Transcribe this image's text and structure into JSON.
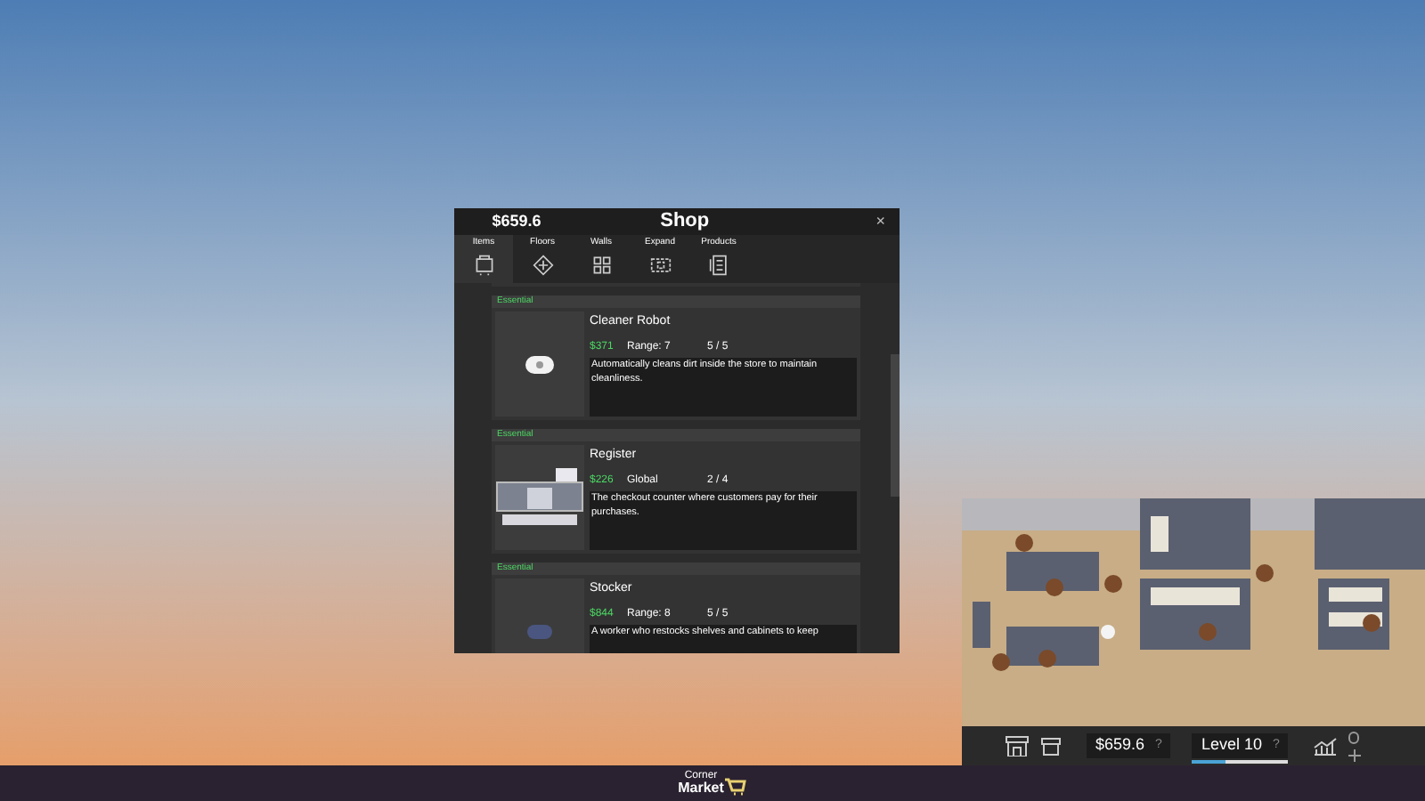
{
  "shop": {
    "money": "$659.6",
    "title": "Shop",
    "close": "×",
    "tabs": [
      {
        "label": "Items",
        "selected": true
      },
      {
        "label": "Floors",
        "selected": false
      },
      {
        "label": "Walls",
        "selected": false
      },
      {
        "label": "Expand",
        "selected": false
      },
      {
        "label": "Products",
        "selected": false
      }
    ],
    "items": [
      {
        "category": "Essential",
        "name": "Cleaner Robot",
        "price": "$371",
        "stat": "Range: 7",
        "count": "5 / 5",
        "description": "Automatically cleans dirt inside the store to maintain cleanliness.",
        "kind": "robot"
      },
      {
        "category": "Essential",
        "name": "Register",
        "price": "$226",
        "stat": "Global",
        "count": "2 / 4",
        "description": "The checkout counter where customers pay for their purchases.",
        "kind": "register"
      },
      {
        "category": "Essential",
        "name": "Stocker",
        "price": "$844",
        "stat": "Range: 8",
        "count": "5 / 5",
        "description": "A worker who restocks shelves and cabinets to keep",
        "kind": "worker"
      }
    ]
  },
  "game_bar": {
    "money": "$659.6",
    "money_help": "?",
    "level": "Level 10",
    "level_help": "?",
    "xp": {
      "level": 0.35
    }
  },
  "taskbar": {
    "logo_line_1": "Corner",
    "logo_line_2": "Market"
  }
}
